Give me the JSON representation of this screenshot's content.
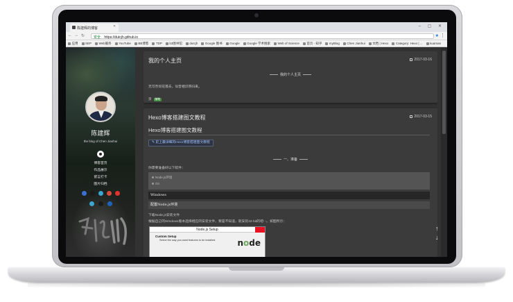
{
  "browser": {
    "tab_title": "陈建辉的博客",
    "address_secure_label": "安全",
    "url": "https://dutcjh.github.io",
    "bookmarks": [
      "应用",
      "SEP",
      "Web服务",
      "YouTube",
      "BB博客",
      "TDP",
      "b3图书馆",
      "dutcjh",
      "Google 图书",
      "Google",
      "Google 学术搜索",
      "Web of Science",
      "首页 - 知乎",
      "myBlog",
      "Chen Jianhui",
      "文档 | Hexo",
      "Category: Hexo | ...",
      "kuaman"
    ]
  },
  "sidebar": {
    "author_name": "陈建辉",
    "subtitle": "the blog of Chen Jianhui",
    "nav": [
      "博客首页",
      "作品展示",
      "留言打卡",
      "图片归档"
    ],
    "social_top_colors": [
      "#3b6fd3",
      "#1a1a1a",
      "#3aa6d1",
      "#d64b3a",
      "#e0332b"
    ],
    "social_bottom_colors": [
      "#3aa6d1",
      "#1a1a1a",
      "#1d63b8"
    ]
  },
  "posts": [
    {
      "title": "我的个人主页",
      "date": "2017-03-16",
      "subheading": "我的个人主页",
      "summary": "无可奈何花落去，似曾相识燕归来。",
      "tag_prefix": "页",
      "tag": "随笔"
    },
    {
      "title": "Hexo博客搭建图文教程",
      "date": "2017-03-15",
      "heading": "Hexo博客搭建图文教程",
      "link_button": "史上最详细的Hexo博客搭建图文教程",
      "section": "一、准备",
      "prep_text": "你需要准备好以下软件：",
      "software": [
        "Node.js环境",
        "Git"
      ],
      "bar1": "Windows",
      "bar2": "配置Node.js环境",
      "para1": "下载Node.js安装文件",
      "para2": "根据自己的Windows版本选择相应的安装文件，要是不知道，就安装32-bit的吧- -。如图所示：",
      "setup_title": "Node.js Setup",
      "setup_subtitle": "Custom Setup",
      "setup_desc": "Select the way you want features to be installed."
    }
  ]
}
